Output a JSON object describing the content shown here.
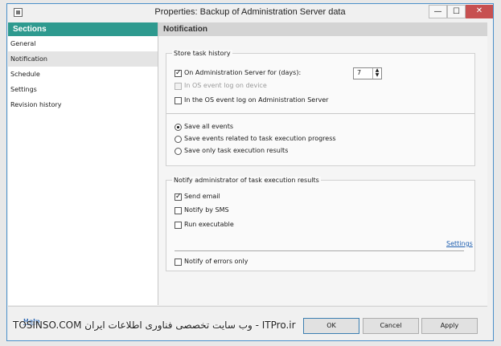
{
  "window": {
    "title": "Properties: Backup of Administration Server data",
    "minimize_glyph": "—",
    "maximize_glyph": "☐",
    "close_glyph": "✕"
  },
  "sidebar": {
    "header": "Sections",
    "items": [
      {
        "label": "General",
        "active": false
      },
      {
        "label": "Notification",
        "active": true
      },
      {
        "label": "Schedule",
        "active": false
      },
      {
        "label": "Settings",
        "active": false
      },
      {
        "label": "Revision history",
        "active": false
      }
    ]
  },
  "main": {
    "header": "Notification",
    "store_history": {
      "title": "Store task history",
      "on_admin_server": {
        "label": "On Administration Server for (days):",
        "checked": true
      },
      "days_value": "7",
      "os_event_log_device": {
        "label": "In OS event log on device",
        "checked": false,
        "disabled": true
      },
      "os_event_log_admin": {
        "label": "In the OS event log on Administration Server",
        "checked": false
      },
      "radio_options": [
        {
          "label": "Save all events",
          "selected": true
        },
        {
          "label": "Save events related to task execution progress",
          "selected": false
        },
        {
          "label": "Save only task execution results",
          "selected": false
        }
      ]
    },
    "notify": {
      "title": "Notify administrator of task execution results",
      "send_email": {
        "label": "Send email",
        "checked": true
      },
      "notify_sms": {
        "label": "Notify by SMS",
        "checked": false
      },
      "run_executable": {
        "label": "Run executable",
        "checked": false
      },
      "settings_link": "Settings",
      "errors_only": {
        "label": "Notify of errors only",
        "checked": false
      }
    }
  },
  "footer": {
    "help": "Help",
    "ok": "OK",
    "cancel": "Cancel",
    "apply": "Apply"
  },
  "watermark": "TOSINSO.COM وب سایت تخصصی فناوری اطلاعات ایران - ITPro.ir"
}
